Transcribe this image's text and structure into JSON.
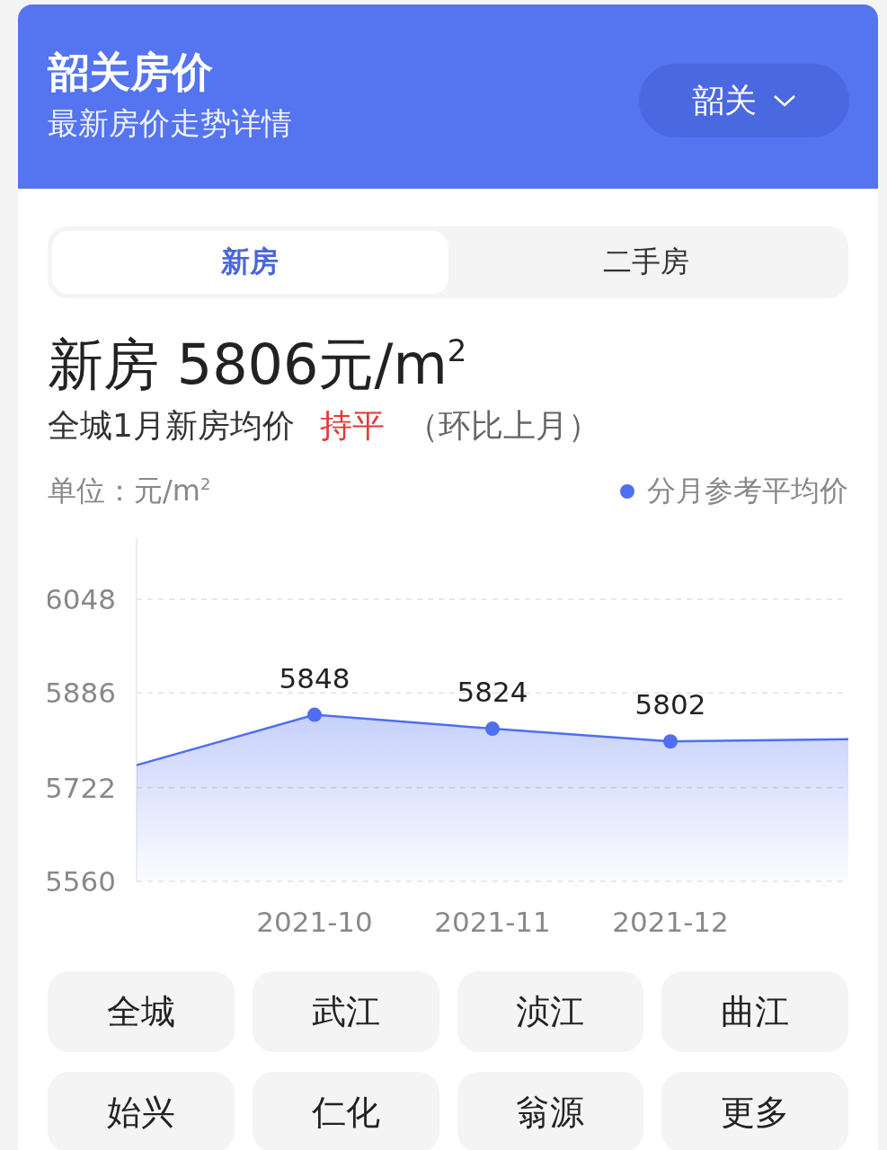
{
  "header": {
    "title": "韶关房价",
    "subtitle": "最新房价走势详情",
    "city_picker": {
      "label": "韶关"
    }
  },
  "tabs": [
    {
      "label": "新房",
      "selected": true
    },
    {
      "label": "二手房",
      "selected": false
    }
  ],
  "price": {
    "headline": "新房 5806元/m$^{2}$",
    "summary": "全城1月新房均价",
    "trend": "持平",
    "trend_note": "（环比上月）"
  },
  "chart": {
    "unit": "单位：元/m$^{2}$",
    "chart_data": {
      "type": "area",
      "categories": [
        null,
        "2021-10",
        "2021-11",
        "2021-12",
        null
      ],
      "ylim": [
        5560,
        6155
      ],
      "grid": true,
      "yticks": [
        5560,
        5722,
        5886,
        6048
      ],
      "series": [
        {
          "name": "分月参考平均价",
          "color": "#4f6ef2",
          "values": [
            5761,
            5848,
            5824,
            5802,
            5806
          ]
        }
      ],
      "value_labels": [
        null,
        "5848",
        "5824",
        "5802",
        null
      ]
    }
  },
  "districts": [
    "全城",
    "武江",
    "浈江",
    "曲江",
    "始兴",
    "仁化",
    "翁源",
    "更多"
  ]
}
